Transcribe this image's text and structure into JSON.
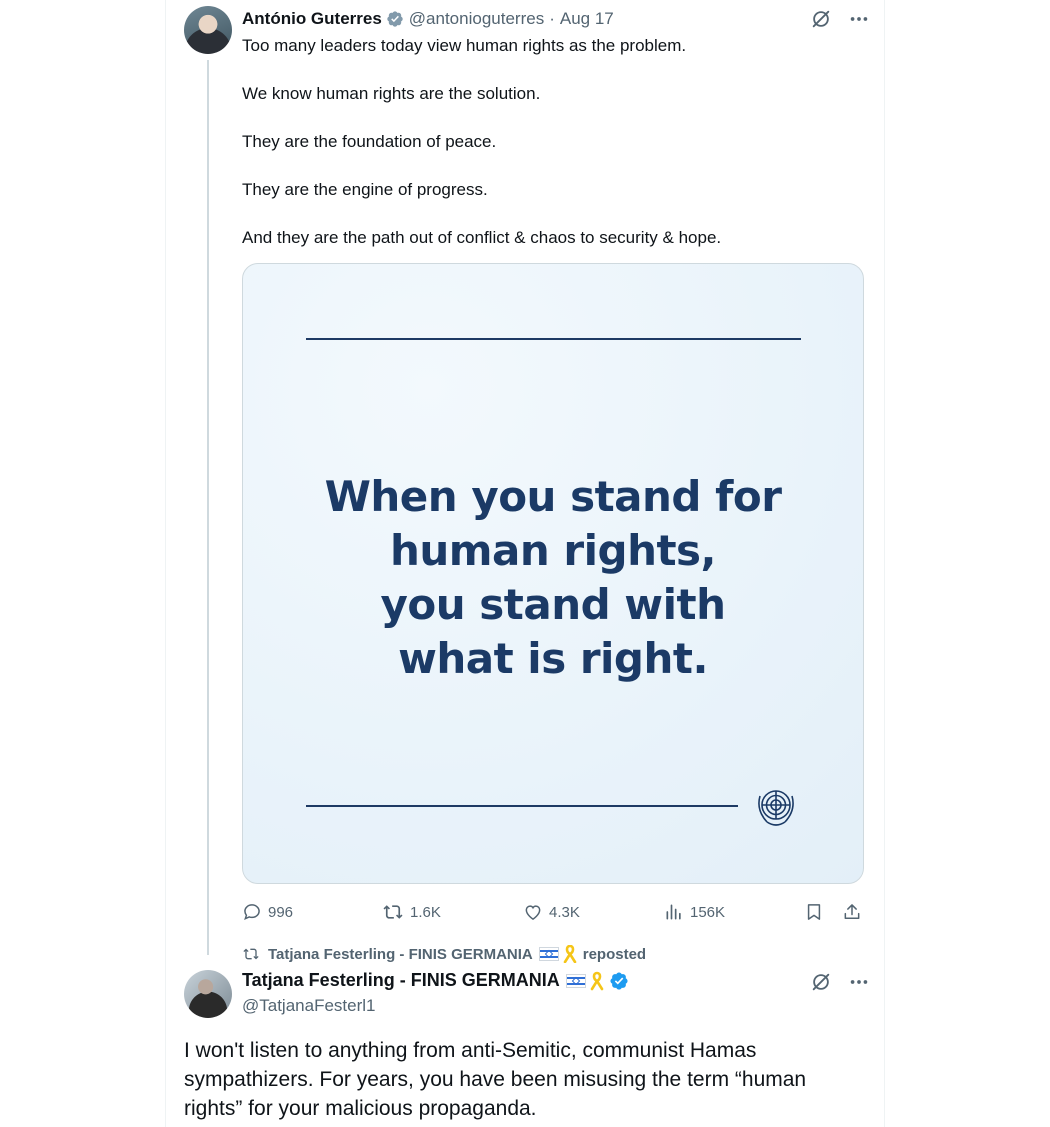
{
  "tweet": {
    "author_name": "António Guterres",
    "handle": "@antonioguterres",
    "separator": "·",
    "date": "Aug 17",
    "paragraphs": [
      "Too many leaders today view human rights as the problem.",
      "We know human rights are the solution.",
      "They are the foundation of peace.",
      "They are the engine of progress.",
      "And they are the path out of conflict & chaos to security & hope."
    ],
    "image_quote_lines": [
      "When you stand for",
      "human rights,",
      "you stand with",
      "what is right."
    ],
    "metrics": {
      "replies": "996",
      "reposts": "1.6K",
      "likes": "4.3K",
      "views": "156K"
    }
  },
  "repost_banner": {
    "reposter": "Tatjana Festerling - FINIS GERMANIA",
    "suffix": "reposted"
  },
  "reply": {
    "author_name": "Tatjana Festerling - FINIS GERMANIA",
    "handle": "@TatjanaFesterl1",
    "text": "I won't listen to anything from anti-Semitic, communist Hamas sympathizers. For years, you have been misusing the term “human rights” for your malicious propaganda."
  },
  "icons": {
    "verified_gray": "verified-badge-gray-icon",
    "verified_blue": "verified-badge-blue-icon",
    "grok": "grok-icon",
    "more": "more-icon",
    "reply": "reply-icon",
    "repost": "repost-icon",
    "like": "heart-icon",
    "views": "views-icon",
    "bookmark": "bookmark-icon",
    "share": "share-icon",
    "flag": "israel-flag-icon",
    "ribbon": "yellow-ribbon-icon"
  },
  "colors": {
    "text": "#0f1419",
    "muted": "#536471",
    "verified_blue": "#1d9bf0",
    "verified_gray": "#829aab",
    "card_text": "#1b3a66"
  }
}
